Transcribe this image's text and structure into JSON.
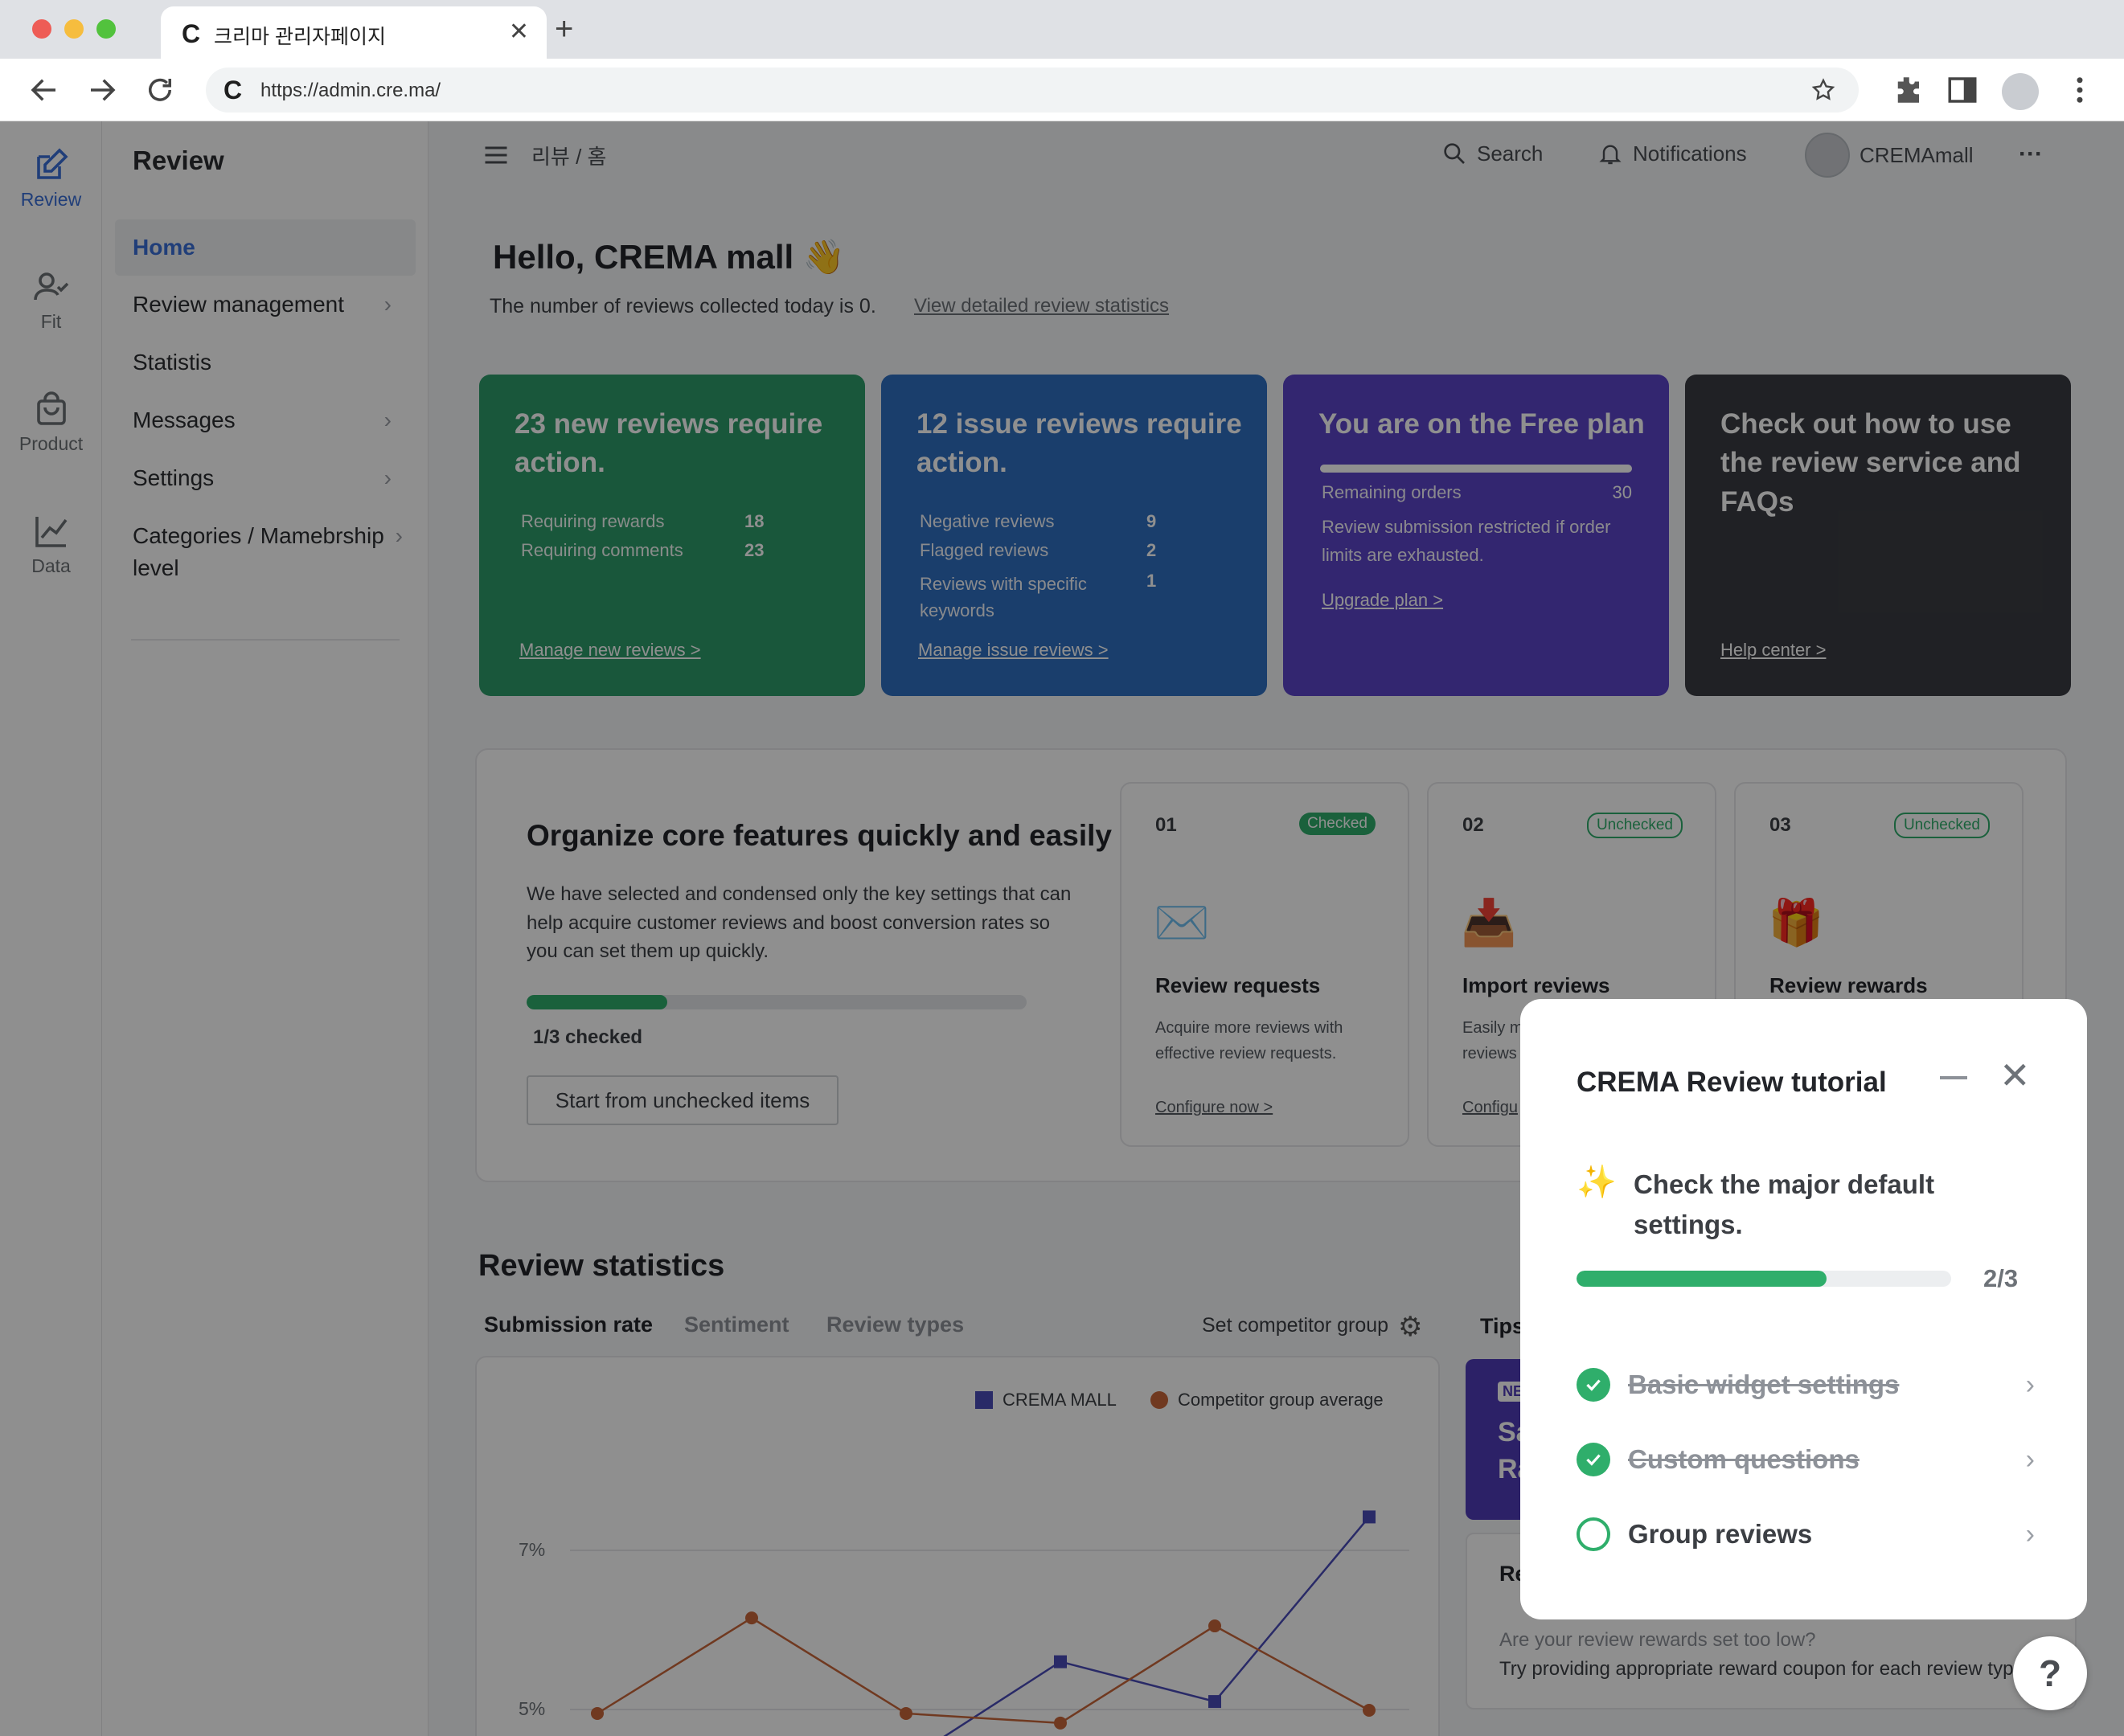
{
  "browser": {
    "tab_title": "크리마 관리자페이지",
    "url": "https://admin.cre.ma/",
    "favicon_letter": "C"
  },
  "icon_rail": [
    {
      "label": "Review",
      "icon": "edit-icon",
      "active": true
    },
    {
      "label": "Fit",
      "icon": "person-check-icon"
    },
    {
      "label": "Product",
      "icon": "shopping-bag-icon"
    },
    {
      "label": "Data",
      "icon": "line-chart-icon"
    }
  ],
  "submenu": {
    "title": "Review",
    "items": [
      {
        "label": "Home",
        "active": true
      },
      {
        "label": "Review management",
        "has_children": true
      },
      {
        "label": "Statistis"
      },
      {
        "label": "Messages",
        "has_children": true
      },
      {
        "label": "Settings",
        "has_children": true
      },
      {
        "label": "Categories / Mamebrship level",
        "has_children": true
      }
    ]
  },
  "topbar": {
    "breadcrumb": "리뷰 / 홈",
    "search": "Search",
    "notifications": "Notifications",
    "user": "CREMAmall",
    "more": "···"
  },
  "greeting": {
    "title": "Hello, CREMA mall 👋",
    "subtitle": "The number of reviews collected today is 0.",
    "link": "View detailed review statistics"
  },
  "cards": {
    "new_reviews": {
      "title": "23 new reviews require action.",
      "rows": [
        {
          "label": "Requiring rewards",
          "value": "18"
        },
        {
          "label": "Requiring comments",
          "value": "23"
        }
      ],
      "link": "Manage new reviews >",
      "color": "#2e9b6a"
    },
    "issue_reviews": {
      "title": "12 issue reviews require action.",
      "rows": [
        {
          "label": "Negative reviews",
          "value": "9"
        },
        {
          "label": "Flagged reviews",
          "value": "2"
        },
        {
          "label": "Reviews with specific keywords",
          "value": "1"
        }
      ],
      "link": "Manage issue reviews >",
      "color": "#2f6fc0"
    },
    "plan": {
      "title": "You are on the Free plan",
      "remaining_label": "Remaining orders",
      "remaining_value": "30",
      "remaining_fraction": 1.0,
      "note": "Review submission restricted if order limits are exhausted.",
      "link": "Upgrade plan >",
      "color": "#5b44c8"
    },
    "help": {
      "title": "Check out how to use the review service and FAQs",
      "link": "Help center >",
      "color": "#3a3c42"
    }
  },
  "setup": {
    "title": "Organize core features quickly and easily",
    "description": "We have selected and condensed only the key settings that can help acquire customer reviews and boost conversion rates so you can set them up quickly.",
    "progress_fraction": 0.2814,
    "count": "1/3 checked",
    "button": "Start from unchecked items",
    "steps": [
      {
        "num": "01",
        "badge": "Checked",
        "checked": true,
        "icon": "envelope-icon",
        "emoji": "✉️",
        "title": "Review requests",
        "desc": "Acquire more reviews with effective review requests.",
        "link": "Configure now >"
      },
      {
        "num": "02",
        "badge": "Unchecked",
        "checked": false,
        "icon": "inbox-download-icon",
        "emoji": "📥",
        "title": "Import reviews",
        "desc": "Easily m",
        "desc2": "reviews",
        "link": "Configu"
      },
      {
        "num": "03",
        "badge": "Unchecked",
        "checked": false,
        "icon": "gift-icon",
        "emoji": "🎁",
        "title": "Review rewards",
        "desc": "",
        "link": ""
      }
    ]
  },
  "stats": {
    "title": "Review statistics",
    "tabs": [
      "Submission rate",
      "Sentiment",
      "Review types"
    ],
    "competitor_label": "Set competitor group",
    "tips_label": "Tips"
  },
  "chart_data": {
    "type": "line",
    "legend": [
      "CREMA MALL",
      "Competitor group average"
    ],
    "yticks": [
      "7%",
      "5%"
    ],
    "series": [
      {
        "name": "CREMA MALL",
        "color": "#4a4bb8",
        "values": [
          null,
          null,
          4.35,
          5.6,
          5.1,
          7.42,
          null
        ]
      },
      {
        "name": "Competitor group average",
        "color": "#c8663a",
        "values": [
          4.95,
          6.15,
          4.95,
          4.83,
          6.05,
          4.99,
          null
        ]
      }
    ],
    "x": [
      0,
      1,
      2,
      3,
      4,
      5,
      6
    ],
    "ylim": [
      4.8,
      7.8
    ]
  },
  "tips": {
    "purple_badge": "NE",
    "purple_text1": "Sa",
    "purple_text2": "Ra",
    "card_title": "Re",
    "card_line1": "Are your review rewards set too low?",
    "card_line2": "Try providing appropriate reward coupon for each review type."
  },
  "tutorial": {
    "title": "CREMA Review tutorial",
    "heading": "Check the major default settings.",
    "count": "2/3",
    "progress_fraction": 0.667,
    "items": [
      {
        "label": "Basic widget settings",
        "done": true
      },
      {
        "label": "Custom questions",
        "done": true
      },
      {
        "label": "Group reviews",
        "done": false
      }
    ]
  },
  "help_button": "?"
}
